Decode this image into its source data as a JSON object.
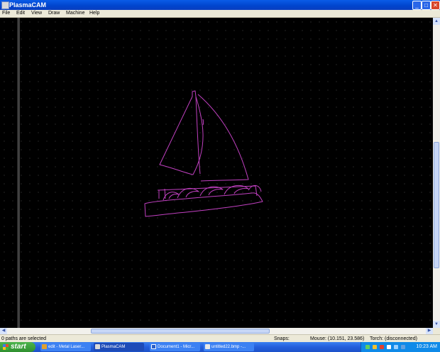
{
  "window": {
    "title": "PlasmaCAM",
    "minimize": "_",
    "maximize": "□",
    "close": "✕"
  },
  "menu": [
    "File",
    "Edit",
    "View",
    "Draw",
    "Machine",
    "Help"
  ],
  "scroll": {
    "up": "▲",
    "down": "▼",
    "left": "◀",
    "right": "▶"
  },
  "status": {
    "selection": "0 paths are selected",
    "snaps": "Snaps:",
    "mouse": "Mouse: (10.151, 23.586)",
    "torch": "Torch: (disconnected)"
  },
  "taskbar": {
    "start": "start",
    "items": [
      {
        "label": "edit - Metal Laser...",
        "active": false
      },
      {
        "label": "PlasmaCAM",
        "active": true
      },
      {
        "label": "Document1 - Micr...",
        "active": false
      },
      {
        "label": "untitled22.bmp -...",
        "active": false
      }
    ],
    "clock": "10:23 AM"
  },
  "colors": {
    "path": "#c040c0",
    "canvas": "#000000",
    "titlebar": "#0a5ce8"
  },
  "drawing": {
    "description_shapes": [
      "sailboat-mainsail",
      "sailboat-jib",
      "boat-hull",
      "wave-cutouts"
    ]
  }
}
